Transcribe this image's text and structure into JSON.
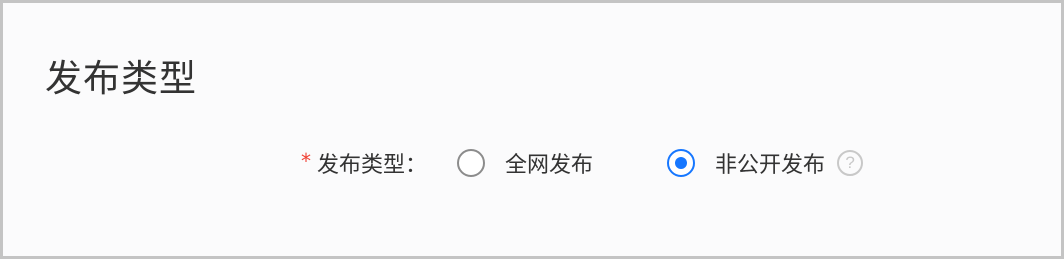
{
  "section": {
    "title": "发布类型"
  },
  "publish_type_field": {
    "required_mark": "*",
    "label": "发布类型：",
    "options": [
      {
        "label": "全网发布",
        "checked": false
      },
      {
        "label": "非公开发布",
        "checked": true
      }
    ],
    "help_icon": "question-circle-icon",
    "help_glyph": "?"
  },
  "colors": {
    "accent": "#1677ff",
    "required": "#f04134",
    "text": "#333333"
  }
}
